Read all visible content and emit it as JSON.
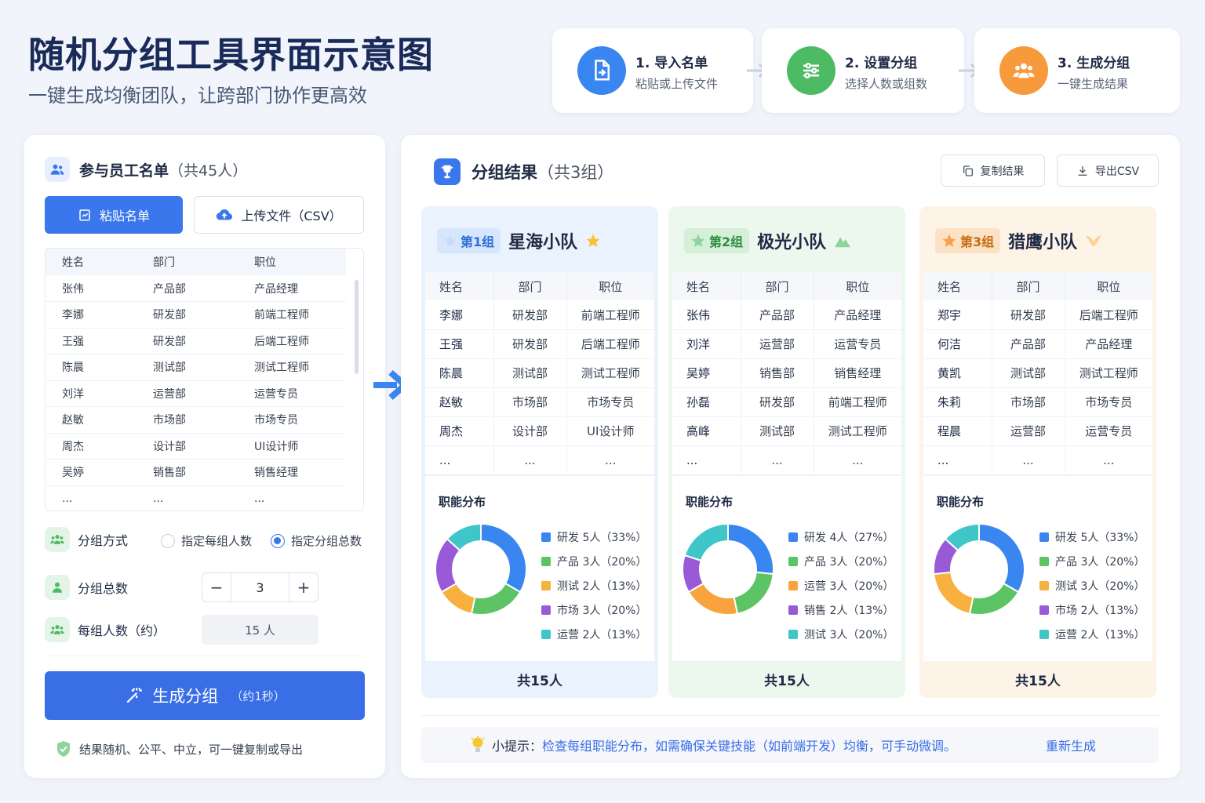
{
  "header": {
    "title": "随机分组工具界面示意图",
    "subtitle": "一键生成均衡团队，让跨部门协作更高效"
  },
  "steps": [
    {
      "title": "1. 导入名单",
      "desc": "粘贴或上传文件",
      "icon": "file-import-icon",
      "color": "#3a86f0"
    },
    {
      "title": "2. 设置分组",
      "desc": "选择人数或组数",
      "icon": "sliders-icon",
      "color": "#4cbb63"
    },
    {
      "title": "3. 生成分组",
      "desc": "一键生成结果",
      "icon": "team-icon",
      "color": "#f79a3c"
    }
  ],
  "left": {
    "title": "参与员工名单",
    "count": "（共45人）",
    "paste_label": "粘贴名单",
    "upload_label": "上传文件（CSV）",
    "columns": [
      "姓名",
      "部门",
      "职位"
    ],
    "rows": [
      [
        "张伟",
        "产品部",
        "产品经理"
      ],
      [
        "李娜",
        "研发部",
        "前端工程师"
      ],
      [
        "王强",
        "研发部",
        "后端工程师"
      ],
      [
        "陈晨",
        "测试部",
        "测试工程师"
      ],
      [
        "刘洋",
        "运营部",
        "运营专员"
      ],
      [
        "赵敏",
        "市场部",
        "市场专员"
      ],
      [
        "周杰",
        "设计部",
        "UI设计师"
      ],
      [
        "吴婷",
        "销售部",
        "销售经理"
      ],
      [
        "...",
        "...",
        "..."
      ]
    ],
    "mode_label": "分组方式",
    "mode_option_1": "指定每组人数",
    "mode_option_2": "指定分组总数",
    "total_label": "分组总数",
    "total_value": "3",
    "minus": "−",
    "plus": "+",
    "per_label": "每组人数（约）",
    "per_value": "15 人",
    "generate_label": "生成分组",
    "generate_hint": "（约1秒）",
    "note": "结果随机、公平、中立，可一键复制或导出"
  },
  "right": {
    "title": "分组结果",
    "count": "（共3组）",
    "copy_label": "复制结果",
    "export_label": "导出CSV",
    "dist_title": "职能分布",
    "columns": [
      "姓名",
      "部门",
      "职位"
    ],
    "groups": [
      {
        "badge": "第1组",
        "name": "星海小队",
        "footer": "共15人",
        "bg": "#eaf2fd",
        "badge_bg": "#d6e6fc",
        "badge_color": "#2f6ed8",
        "rows": [
          [
            "李娜",
            "研发部",
            "前端工程师"
          ],
          [
            "王强",
            "研发部",
            "后端工程师"
          ],
          [
            "陈晨",
            "测试部",
            "测试工程师"
          ],
          [
            "赵敏",
            "市场部",
            "市场专员"
          ],
          [
            "周杰",
            "设计部",
            "UI设计师"
          ],
          [
            "...",
            "...",
            "..."
          ]
        ],
        "legend": [
          {
            "name": "研发",
            "text": "5人（33%）",
            "value": 5,
            "color": "#3a86f0"
          },
          {
            "name": "产品",
            "text": "3人（20%）",
            "value": 3,
            "color": "#5cc464"
          },
          {
            "name": "测试",
            "text": "2人（13%）",
            "value": 2,
            "color": "#f8b13e"
          },
          {
            "name": "市场",
            "text": "3人（20%）",
            "value": 3,
            "color": "#9a5ad8"
          },
          {
            "name": "运营",
            "text": "2人（13%）",
            "value": 2,
            "color": "#3fc6c9"
          }
        ],
        "pie_order": [
          0,
          1,
          2,
          3,
          4
        ]
      },
      {
        "badge": "第2组",
        "name": "极光小队",
        "footer": "共15人",
        "bg": "#ecf8ee",
        "badge_bg": "#d5efd8",
        "badge_color": "#2e8c3f",
        "rows": [
          [
            "张伟",
            "产品部",
            "产品经理"
          ],
          [
            "刘洋",
            "运营部",
            "运营专员"
          ],
          [
            "吴婷",
            "销售部",
            "销售经理"
          ],
          [
            "孙磊",
            "研发部",
            "前端工程师"
          ],
          [
            "高峰",
            "测试部",
            "测试工程师"
          ],
          [
            "...",
            "...",
            "..."
          ]
        ],
        "legend": [
          {
            "name": "研发",
            "text": "4人（27%）",
            "value": 4,
            "color": "#3a86f0"
          },
          {
            "name": "产品",
            "text": "3人（20%）",
            "value": 3,
            "color": "#5cc464"
          },
          {
            "name": "运营",
            "text": "3人（20%）",
            "value": 3,
            "color": "#f8a33e"
          },
          {
            "name": "销售",
            "text": "2人（13%）",
            "value": 2,
            "color": "#9a5ad8"
          },
          {
            "name": "测试",
            "text": "3人（20%）",
            "value": 3,
            "color": "#3fc6c9"
          }
        ],
        "pie_order": [
          0,
          1,
          2,
          3,
          4
        ]
      },
      {
        "badge": "第3组",
        "name": "猎鹰小队",
        "footer": "共15人",
        "bg": "#fdf3e7",
        "badge_bg": "#fbe2c5",
        "badge_color": "#c86a12",
        "rows": [
          [
            "郑宇",
            "研发部",
            "后端工程师"
          ],
          [
            "何洁",
            "产品部",
            "产品经理"
          ],
          [
            "黄凯",
            "测试部",
            "测试工程师"
          ],
          [
            "朱莉",
            "市场部",
            "市场专员"
          ],
          [
            "程晨",
            "运营部",
            "运营专员"
          ],
          [
            "...",
            "...",
            "..."
          ]
        ],
        "legend": [
          {
            "name": "研发",
            "text": "5人（33%）",
            "value": 5,
            "color": "#3a86f0"
          },
          {
            "name": "产品",
            "text": "3人（20%）",
            "value": 3,
            "color": "#5cc464"
          },
          {
            "name": "测试",
            "text": "3人（20%）",
            "value": 3,
            "color": "#f8b13e"
          },
          {
            "name": "市场",
            "text": "2人（13%）",
            "value": 2,
            "color": "#9a5ad8"
          },
          {
            "name": "运营",
            "text": "2人（13%）",
            "value": 2,
            "color": "#3fc6c9"
          }
        ],
        "pie_order": [
          0,
          1,
          2,
          3,
          4
        ]
      }
    ],
    "tip_label": "小提示：",
    "tip_text": "检查每组职能分布，如需确保关键技能（如前端开发）均衡，可手动微调。",
    "regen_label": "重新生成"
  }
}
